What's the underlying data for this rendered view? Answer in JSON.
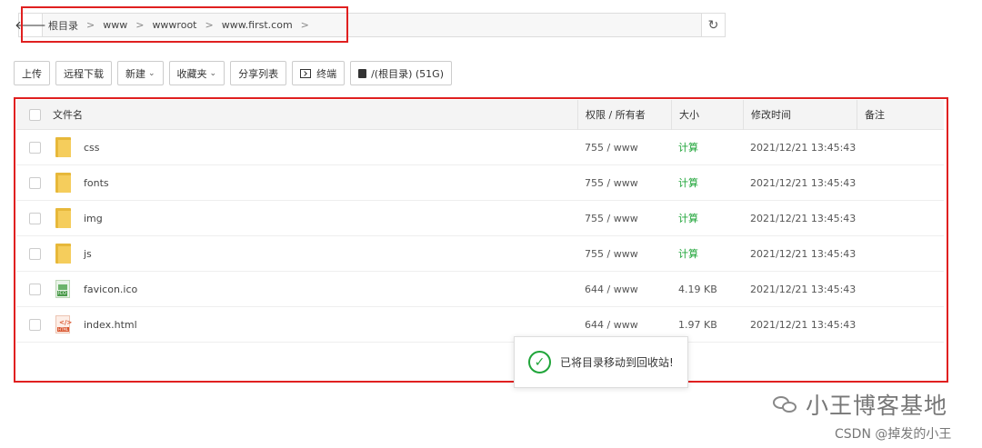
{
  "breadcrumb": {
    "items": [
      "根目录",
      "www",
      "wwwroot",
      "www.first.com"
    ],
    "separator": ">"
  },
  "toolbar": {
    "upload": "上传",
    "remote_download": "远程下载",
    "new": "新建",
    "favorites": "收藏夹",
    "share_list": "分享列表",
    "terminal": "终端",
    "disk": "/(根目录) (51G)"
  },
  "table": {
    "headers": {
      "name": "文件名",
      "perm": "权限 / 所有者",
      "size": "大小",
      "mtime": "修改时间",
      "note": "备注"
    },
    "rows": [
      {
        "name": "css",
        "type": "folder-icon",
        "perm": "755 / www",
        "size": "计算",
        "mtime": "2021/12/21 13:45:43",
        "note": ""
      },
      {
        "name": "fonts",
        "type": "folder-icon",
        "perm": "755 / www",
        "size": "计算",
        "mtime": "2021/12/21 13:45:43",
        "note": ""
      },
      {
        "name": "img",
        "type": "folder-icon",
        "perm": "755 / www",
        "size": "计算",
        "mtime": "2021/12/21 13:45:43",
        "note": ""
      },
      {
        "name": "js",
        "type": "folder-icon",
        "perm": "755 / www",
        "size": "计算",
        "mtime": "2021/12/21 13:45:43",
        "note": ""
      },
      {
        "name": "favicon.ico",
        "type": "image-file-icon",
        "perm": "644 / www",
        "size": "4.19 KB",
        "mtime": "2021/12/21 13:45:43",
        "note": ""
      },
      {
        "name": "index.html",
        "type": "html-file-icon",
        "perm": "644 / www",
        "size": "1.97 KB",
        "mtime": "2021/12/21 13:45:43",
        "note": ""
      }
    ]
  },
  "toast": {
    "message": "已将目录移动到回收站!"
  },
  "watermark": {
    "channel": "小王博客基地",
    "csdn": "CSDN @掉发的小王"
  },
  "colors": {
    "accent_green": "#20a53a",
    "highlight_red": "#e02020"
  }
}
